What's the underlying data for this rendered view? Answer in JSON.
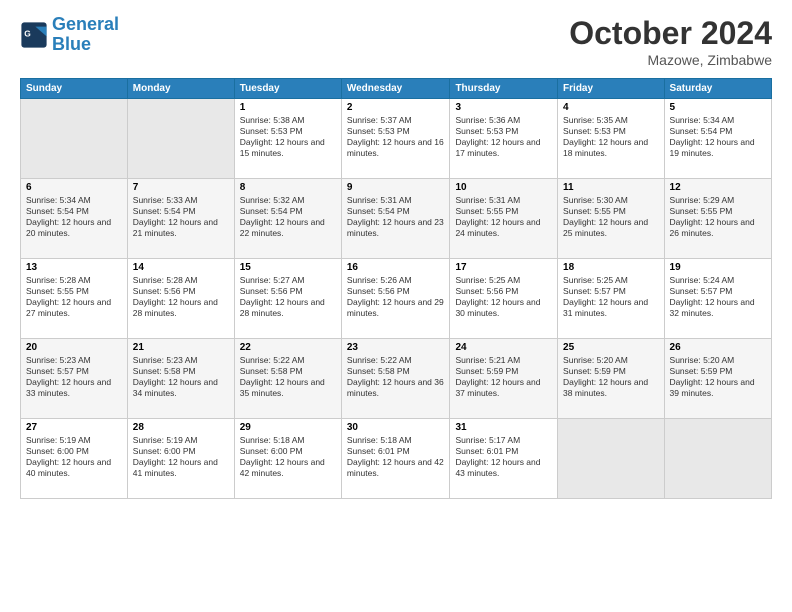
{
  "logo": {
    "line1": "General",
    "line2": "Blue"
  },
  "title": "October 2024",
  "location": "Mazowe, Zimbabwe",
  "days_header": [
    "Sunday",
    "Monday",
    "Tuesday",
    "Wednesday",
    "Thursday",
    "Friday",
    "Saturday"
  ],
  "weeks": [
    [
      {
        "num": "",
        "sunrise": "",
        "sunset": "",
        "daylight": "",
        "empty": true
      },
      {
        "num": "",
        "sunrise": "",
        "sunset": "",
        "daylight": "",
        "empty": true
      },
      {
        "num": "1",
        "sunrise": "Sunrise: 5:38 AM",
        "sunset": "Sunset: 5:53 PM",
        "daylight": "Daylight: 12 hours and 15 minutes.",
        "empty": false
      },
      {
        "num": "2",
        "sunrise": "Sunrise: 5:37 AM",
        "sunset": "Sunset: 5:53 PM",
        "daylight": "Daylight: 12 hours and 16 minutes.",
        "empty": false
      },
      {
        "num": "3",
        "sunrise": "Sunrise: 5:36 AM",
        "sunset": "Sunset: 5:53 PM",
        "daylight": "Daylight: 12 hours and 17 minutes.",
        "empty": false
      },
      {
        "num": "4",
        "sunrise": "Sunrise: 5:35 AM",
        "sunset": "Sunset: 5:53 PM",
        "daylight": "Daylight: 12 hours and 18 minutes.",
        "empty": false
      },
      {
        "num": "5",
        "sunrise": "Sunrise: 5:34 AM",
        "sunset": "Sunset: 5:54 PM",
        "daylight": "Daylight: 12 hours and 19 minutes.",
        "empty": false
      }
    ],
    [
      {
        "num": "6",
        "sunrise": "Sunrise: 5:34 AM",
        "sunset": "Sunset: 5:54 PM",
        "daylight": "Daylight: 12 hours and 20 minutes.",
        "empty": false
      },
      {
        "num": "7",
        "sunrise": "Sunrise: 5:33 AM",
        "sunset": "Sunset: 5:54 PM",
        "daylight": "Daylight: 12 hours and 21 minutes.",
        "empty": false
      },
      {
        "num": "8",
        "sunrise": "Sunrise: 5:32 AM",
        "sunset": "Sunset: 5:54 PM",
        "daylight": "Daylight: 12 hours and 22 minutes.",
        "empty": false
      },
      {
        "num": "9",
        "sunrise": "Sunrise: 5:31 AM",
        "sunset": "Sunset: 5:54 PM",
        "daylight": "Daylight: 12 hours and 23 minutes.",
        "empty": false
      },
      {
        "num": "10",
        "sunrise": "Sunrise: 5:31 AM",
        "sunset": "Sunset: 5:55 PM",
        "daylight": "Daylight: 12 hours and 24 minutes.",
        "empty": false
      },
      {
        "num": "11",
        "sunrise": "Sunrise: 5:30 AM",
        "sunset": "Sunset: 5:55 PM",
        "daylight": "Daylight: 12 hours and 25 minutes.",
        "empty": false
      },
      {
        "num": "12",
        "sunrise": "Sunrise: 5:29 AM",
        "sunset": "Sunset: 5:55 PM",
        "daylight": "Daylight: 12 hours and 26 minutes.",
        "empty": false
      }
    ],
    [
      {
        "num": "13",
        "sunrise": "Sunrise: 5:28 AM",
        "sunset": "Sunset: 5:55 PM",
        "daylight": "Daylight: 12 hours and 27 minutes.",
        "empty": false
      },
      {
        "num": "14",
        "sunrise": "Sunrise: 5:28 AM",
        "sunset": "Sunset: 5:56 PM",
        "daylight": "Daylight: 12 hours and 28 minutes.",
        "empty": false
      },
      {
        "num": "15",
        "sunrise": "Sunrise: 5:27 AM",
        "sunset": "Sunset: 5:56 PM",
        "daylight": "Daylight: 12 hours and 28 minutes.",
        "empty": false
      },
      {
        "num": "16",
        "sunrise": "Sunrise: 5:26 AM",
        "sunset": "Sunset: 5:56 PM",
        "daylight": "Daylight: 12 hours and 29 minutes.",
        "empty": false
      },
      {
        "num": "17",
        "sunrise": "Sunrise: 5:25 AM",
        "sunset": "Sunset: 5:56 PM",
        "daylight": "Daylight: 12 hours and 30 minutes.",
        "empty": false
      },
      {
        "num": "18",
        "sunrise": "Sunrise: 5:25 AM",
        "sunset": "Sunset: 5:57 PM",
        "daylight": "Daylight: 12 hours and 31 minutes.",
        "empty": false
      },
      {
        "num": "19",
        "sunrise": "Sunrise: 5:24 AM",
        "sunset": "Sunset: 5:57 PM",
        "daylight": "Daylight: 12 hours and 32 minutes.",
        "empty": false
      }
    ],
    [
      {
        "num": "20",
        "sunrise": "Sunrise: 5:23 AM",
        "sunset": "Sunset: 5:57 PM",
        "daylight": "Daylight: 12 hours and 33 minutes.",
        "empty": false
      },
      {
        "num": "21",
        "sunrise": "Sunrise: 5:23 AM",
        "sunset": "Sunset: 5:58 PM",
        "daylight": "Daylight: 12 hours and 34 minutes.",
        "empty": false
      },
      {
        "num": "22",
        "sunrise": "Sunrise: 5:22 AM",
        "sunset": "Sunset: 5:58 PM",
        "daylight": "Daylight: 12 hours and 35 minutes.",
        "empty": false
      },
      {
        "num": "23",
        "sunrise": "Sunrise: 5:22 AM",
        "sunset": "Sunset: 5:58 PM",
        "daylight": "Daylight: 12 hours and 36 minutes.",
        "empty": false
      },
      {
        "num": "24",
        "sunrise": "Sunrise: 5:21 AM",
        "sunset": "Sunset: 5:59 PM",
        "daylight": "Daylight: 12 hours and 37 minutes.",
        "empty": false
      },
      {
        "num": "25",
        "sunrise": "Sunrise: 5:20 AM",
        "sunset": "Sunset: 5:59 PM",
        "daylight": "Daylight: 12 hours and 38 minutes.",
        "empty": false
      },
      {
        "num": "26",
        "sunrise": "Sunrise: 5:20 AM",
        "sunset": "Sunset: 5:59 PM",
        "daylight": "Daylight: 12 hours and 39 minutes.",
        "empty": false
      }
    ],
    [
      {
        "num": "27",
        "sunrise": "Sunrise: 5:19 AM",
        "sunset": "Sunset: 6:00 PM",
        "daylight": "Daylight: 12 hours and 40 minutes.",
        "empty": false
      },
      {
        "num": "28",
        "sunrise": "Sunrise: 5:19 AM",
        "sunset": "Sunset: 6:00 PM",
        "daylight": "Daylight: 12 hours and 41 minutes.",
        "empty": false
      },
      {
        "num": "29",
        "sunrise": "Sunrise: 5:18 AM",
        "sunset": "Sunset: 6:00 PM",
        "daylight": "Daylight: 12 hours and 42 minutes.",
        "empty": false
      },
      {
        "num": "30",
        "sunrise": "Sunrise: 5:18 AM",
        "sunset": "Sunset: 6:01 PM",
        "daylight": "Daylight: 12 hours and 42 minutes.",
        "empty": false
      },
      {
        "num": "31",
        "sunrise": "Sunrise: 5:17 AM",
        "sunset": "Sunset: 6:01 PM",
        "daylight": "Daylight: 12 hours and 43 minutes.",
        "empty": false
      },
      {
        "num": "",
        "sunrise": "",
        "sunset": "",
        "daylight": "",
        "empty": true
      },
      {
        "num": "",
        "sunrise": "",
        "sunset": "",
        "daylight": "",
        "empty": true
      }
    ]
  ]
}
